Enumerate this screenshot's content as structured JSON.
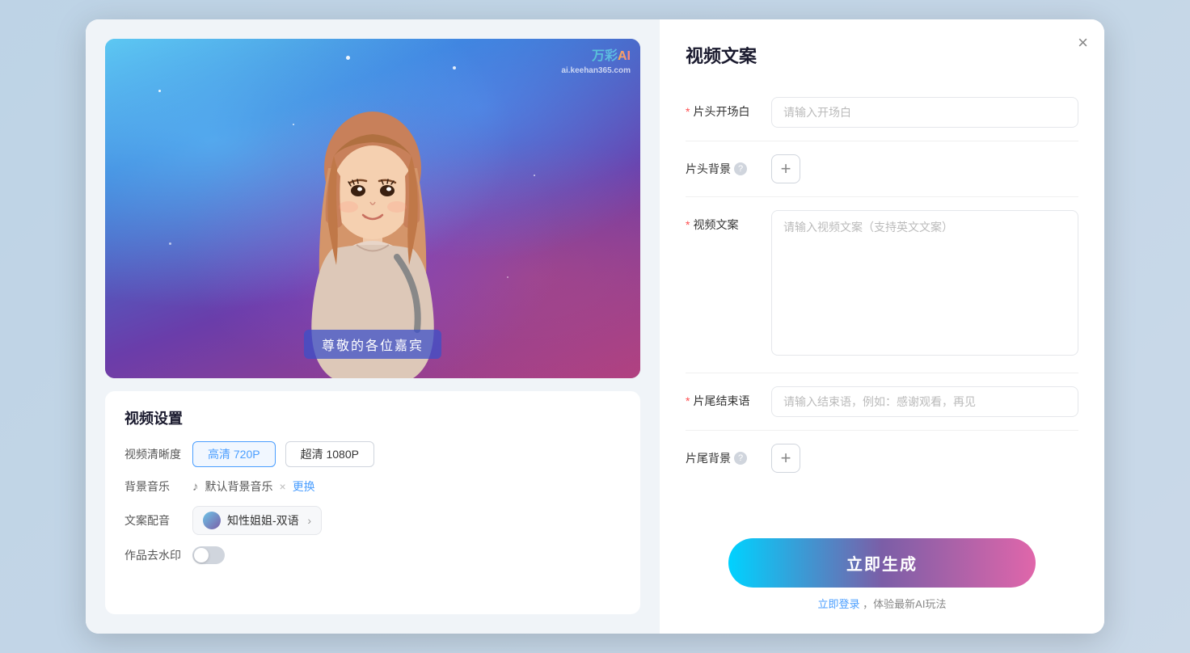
{
  "modal": {
    "close_label": "×"
  },
  "left": {
    "subtitle": "尊敬的各位嘉宾",
    "watermark_brand": "万彩",
    "watermark_ai": "AI",
    "watermark_site": "ai.keehan365.com",
    "settings_title": "视频设置",
    "quality_label": "视频清晰度",
    "quality_options": [
      {
        "label": "高清 720P",
        "active": true
      },
      {
        "label": "超清 1080P",
        "active": false
      }
    ],
    "music_label": "背景音乐",
    "music_name": "默认背景音乐",
    "music_change": "更换",
    "voice_label": "文案配音",
    "voice_name": "知性姐姐-双语",
    "watermark_label": "作品去水印",
    "toggle_off": false
  },
  "right": {
    "title": "视频文案",
    "opening_label": "片头开场白",
    "opening_placeholder": "请输入开场白",
    "opening_required": true,
    "bg_header_label": "片头背景",
    "bg_header_help": true,
    "content_label": "视频文案",
    "content_placeholder": "请输入视频文案（支持英文文案）",
    "content_required": true,
    "closing_label": "片尾结束语",
    "closing_placeholder": "请输入结束语，例如：感谢观看，再见",
    "closing_required": true,
    "bg_footer_label": "片尾背景",
    "bg_footer_help": true,
    "generate_label": "立即生成",
    "login_hint": "立即登录，体验最新AI玩法",
    "login_action": "立即登录"
  }
}
